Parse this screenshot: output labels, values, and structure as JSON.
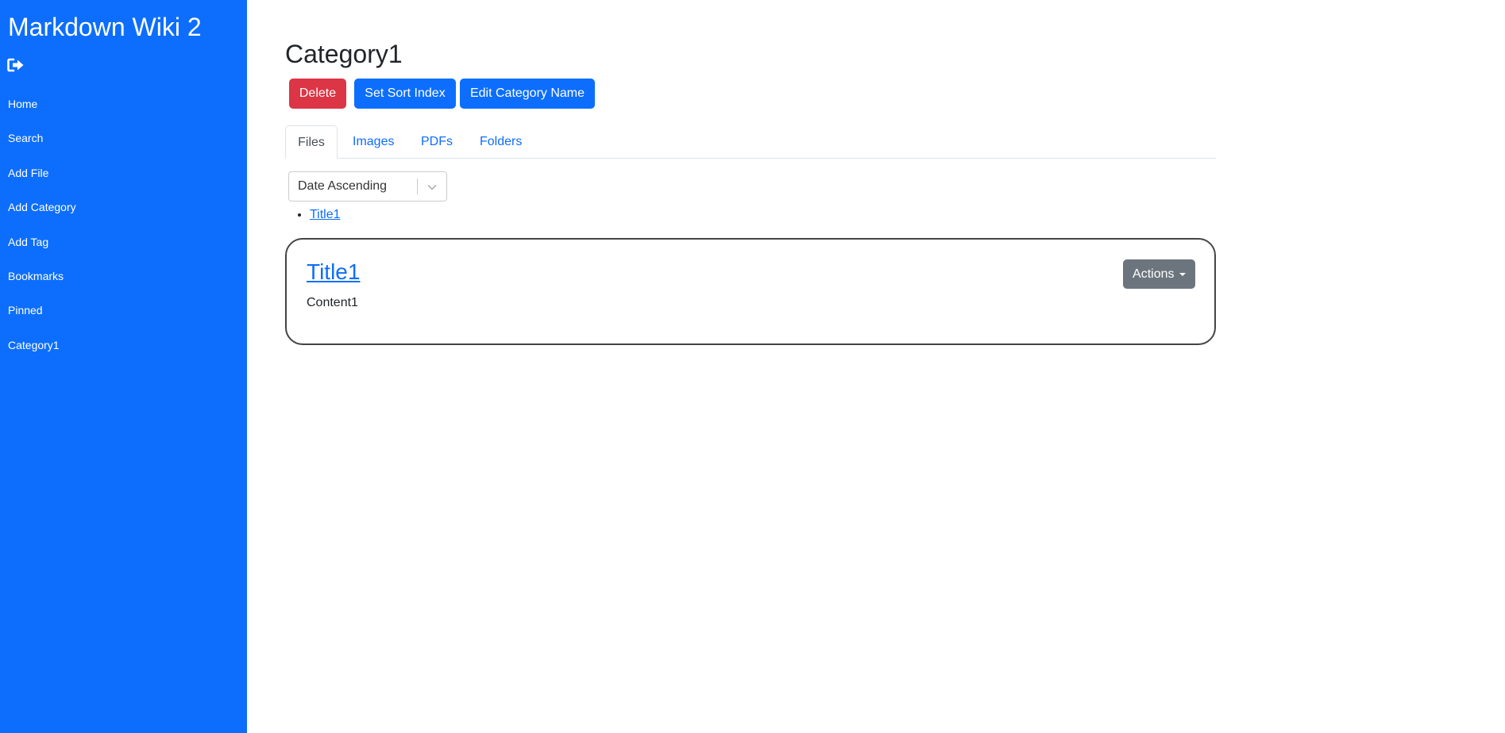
{
  "app": {
    "title": "Markdown Wiki 2",
    "logout_icon": "sign-out-icon"
  },
  "sidebar": {
    "items": [
      {
        "label": "Home"
      },
      {
        "label": "Search"
      },
      {
        "label": "Add File"
      },
      {
        "label": "Add Category"
      },
      {
        "label": "Add Tag"
      },
      {
        "label": "Bookmarks"
      },
      {
        "label": "Pinned"
      },
      {
        "label": "Category1"
      }
    ]
  },
  "page": {
    "title": "Category1"
  },
  "toolbar": {
    "delete_label": "Delete",
    "sort_index_label": "Set Sort Index",
    "edit_name_label": "Edit Category Name"
  },
  "tabs": [
    {
      "label": "Files",
      "active": true
    },
    {
      "label": "Images",
      "active": false
    },
    {
      "label": "PDFs",
      "active": false
    },
    {
      "label": "Folders",
      "active": false
    }
  ],
  "sort": {
    "selected": "Date Ascending",
    "icon": "chevron-down-icon"
  },
  "files": [
    {
      "title": "Title1"
    }
  ],
  "card": {
    "title": "Title1",
    "content": "Content1",
    "actions_label": "Actions"
  },
  "colors": {
    "primary": "#0d6efd",
    "danger": "#dc3545",
    "secondary": "#6c757d"
  }
}
